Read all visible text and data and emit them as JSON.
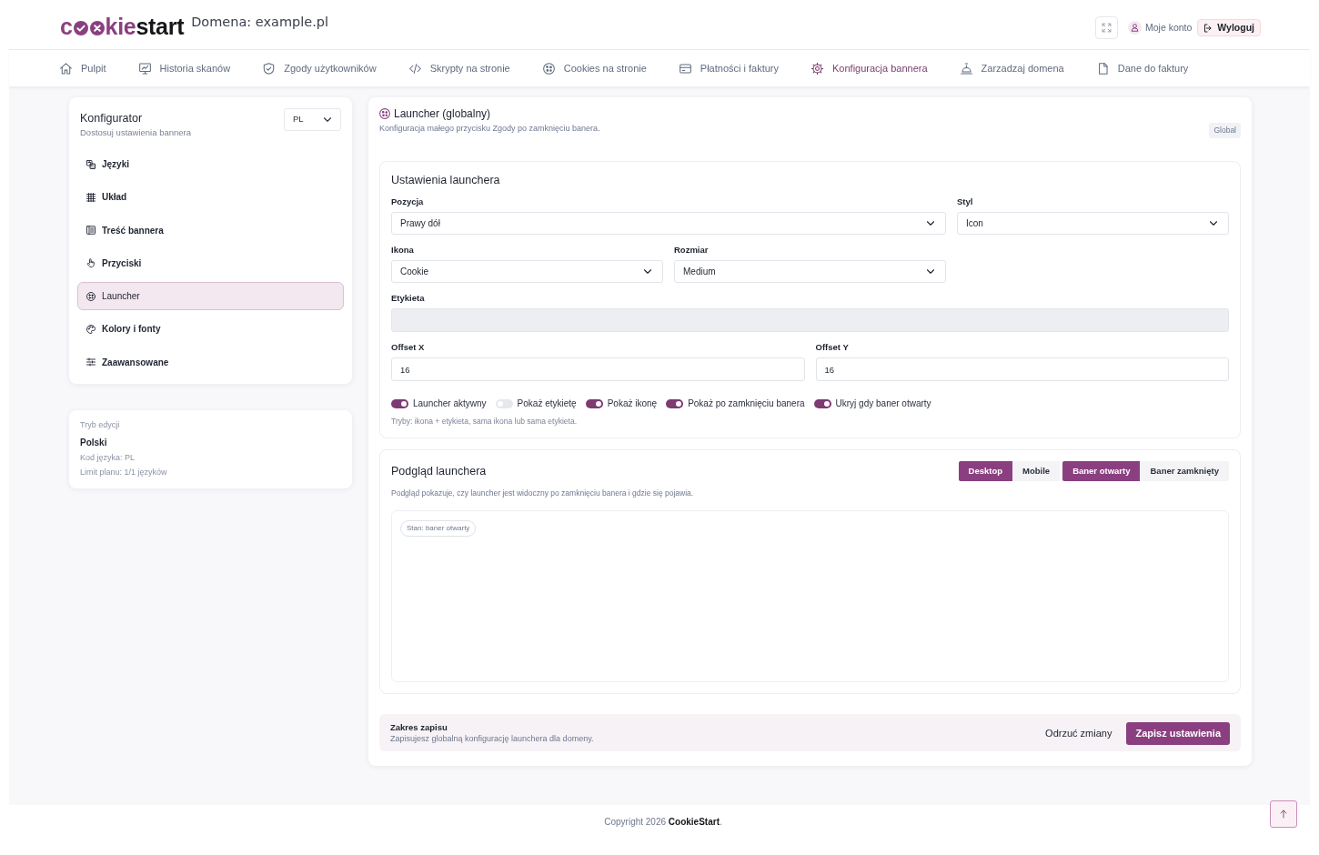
{
  "header": {
    "logo": {
      "prefix": "c",
      "accent": "kie",
      "suffix": "start"
    },
    "domain": "Domena: example.pl",
    "account": "Moje konto",
    "logout": "Wyloguj"
  },
  "nav": [
    {
      "label": "Pulpit",
      "selected": false
    },
    {
      "label": "Historia skanów",
      "selected": false
    },
    {
      "label": "Zgody użytkowników",
      "selected": false
    },
    {
      "label": "Skrypty na stronie",
      "selected": false
    },
    {
      "label": "Cookies na stronie",
      "selected": false
    },
    {
      "label": "Płatności i faktury",
      "selected": false
    },
    {
      "label": "Konfiguracja bannera",
      "selected": true
    },
    {
      "label": "Zarzadzaj domena",
      "selected": false
    },
    {
      "label": "Dane do faktury",
      "selected": false
    }
  ],
  "sidebar": {
    "title": "Konfigurator",
    "subtitle": "Dostosuj ustawienia bannera",
    "language_select": "PL",
    "items": [
      {
        "label": "Języki",
        "selected": false
      },
      {
        "label": "Układ",
        "selected": false
      },
      {
        "label": "Treść bannera",
        "selected": false
      },
      {
        "label": "Przyciski",
        "selected": false
      },
      {
        "label": "Launcher",
        "selected": true
      },
      {
        "label": "Kolory i fonty",
        "selected": false
      },
      {
        "label": "Zaawansowane",
        "selected": false
      }
    ]
  },
  "edit_info": {
    "label": "Tryb edycji",
    "language": "Polski",
    "code": "Kod języka: PL",
    "limit": "Limit planu: 1/1 języków"
  },
  "panel": {
    "title": "Launcher (globalny)",
    "subtitle": "Konfiguracja małego przycisku Zgody po zamknięciu banera.",
    "badge": "Global"
  },
  "settings": {
    "title": "Ustawienia launchera",
    "fields": [
      {
        "label": "Pozycja",
        "kind": "select",
        "value": "Prawy dół",
        "disabled": false
      },
      {
        "label": "Styl",
        "kind": "select",
        "value": "Icon",
        "disabled": false
      },
      {
        "label": "Ikona",
        "kind": "select",
        "value": "Cookie",
        "disabled": false
      },
      {
        "label": "Rozmiar",
        "kind": "select",
        "value": "Medium",
        "disabled": false
      },
      {
        "label": "Etykieta",
        "kind": "text",
        "disabled": true
      },
      {
        "label": "Offset X",
        "kind": "text",
        "value": "16",
        "disabled": false
      },
      {
        "label": "Offset Y",
        "kind": "text",
        "value": "16",
        "disabled": false
      }
    ],
    "toggles": [
      {
        "label": "Launcher aktywny",
        "on": true
      },
      {
        "label": "Pokaż etykietę",
        "on": false
      },
      {
        "label": "Pokaż ikonę",
        "on": true
      },
      {
        "label": "Pokaż po zamknięciu banera",
        "on": true
      },
      {
        "label": "Ukryj gdy baner otwarty",
        "on": true
      }
    ],
    "hint": "Tryby: ikona + etykieta, sama ikona lub sama etykieta."
  },
  "preview": {
    "title": "Podgląd launchera",
    "device_buttons": [
      {
        "label": "Desktop",
        "selected": true
      },
      {
        "label": "Mobile",
        "selected": false
      }
    ],
    "state_buttons": [
      {
        "label": "Baner otwarty",
        "selected": true
      },
      {
        "label": "Baner zamknięty",
        "selected": false
      }
    ],
    "description": "Podgląd pokazuje, czy launcher jest widoczny po zamknięciu banera i gdzie się pojawia.",
    "state_pill": "Stan: baner otwarty"
  },
  "save_bar": {
    "title": "Zakres zapisu",
    "description": "Zapisujesz globalną konfigurację launchera dla domeny.",
    "discard": "Odrzuć zmiany",
    "save": "Zapisz ustawienia"
  },
  "footer": "Copyright 2026 **CookieStart**."
}
